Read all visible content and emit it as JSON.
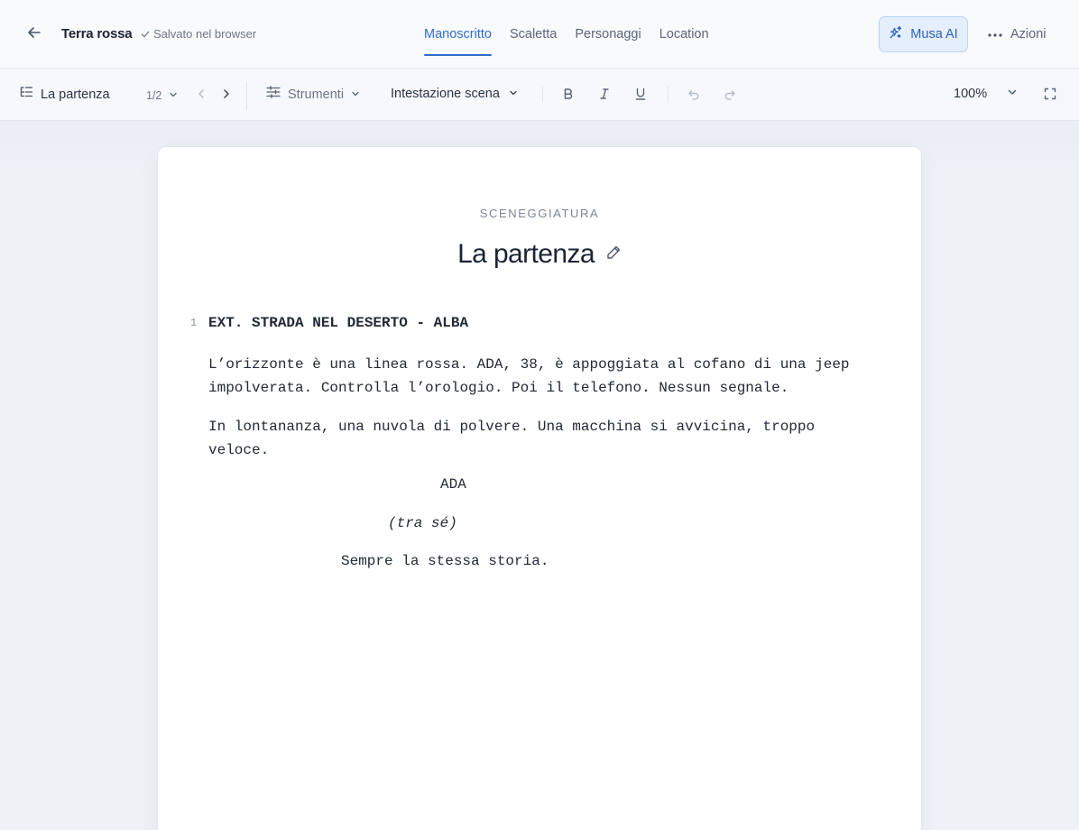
{
  "topbar": {
    "doc_title": "Terra rossa",
    "save_status": "Salvato nel browser",
    "tabs": [
      {
        "label": "Manoscritto",
        "active": true
      },
      {
        "label": "Scaletta",
        "active": false
      },
      {
        "label": "Personaggi",
        "active": false
      },
      {
        "label": "Location",
        "active": false
      }
    ],
    "muse_label": "Musa AI",
    "actions_label": "Azioni"
  },
  "toolbar": {
    "scene_name": "La partenza",
    "page_indicator": "1/2",
    "tools_label": "Strumenti",
    "element_type": "Intestazione scena",
    "zoom": "100%"
  },
  "document": {
    "kicker": "SCENEGGIATURA",
    "scene_title": "La partenza",
    "line_number": "1",
    "slugline": "EXT. STRADA NEL DESERTO - ALBA",
    "action_1": "L’orizzonte è una linea rossa. ADA, 38, è appoggiata al cofano di una jeep impolverata. Controlla l’orologio. Poi il telefono. Nessun segnale.",
    "action_2": "In lontananza, una nuvola di polvere. Una macchina si avvicina, troppo veloce.",
    "character": "ADA",
    "parenthetical": "(tra sé)",
    "dialogue": "Sempre la stessa storia."
  },
  "colors": {
    "accent": "#2f6fd0",
    "accent_bg": "#e4eefc",
    "text_primary": "#1b2433",
    "text_muted": "#6b7687",
    "canvas_bg": "#eef2f7"
  }
}
